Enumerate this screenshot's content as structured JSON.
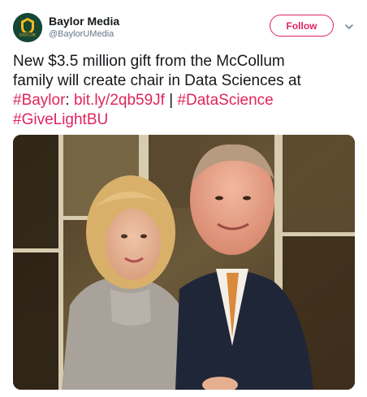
{
  "account": {
    "display_name": "Baylor Media",
    "handle": "@BaylorUMedia",
    "avatar_text": "BAYLOR"
  },
  "follow_label": "Follow",
  "tweet": {
    "line1": "New $3.5 million gift from the McCollum",
    "line2": "family will create chair in Data Sciences at",
    "hashtag_baylor": "#Baylor",
    "colon": ":",
    "short_link": "bit.ly/2qb59Jf",
    "separator": "|",
    "hashtag_datascience": "#DataScience",
    "hashtag_givelight": "#GiveLightBU"
  },
  "colors": {
    "accent": "#e0245e",
    "text": "#14171a",
    "muted": "#657786",
    "avatar_bg": "#154734",
    "avatar_gold": "#ffb81c"
  },
  "icons": {
    "caret": "chevron-down-icon"
  }
}
